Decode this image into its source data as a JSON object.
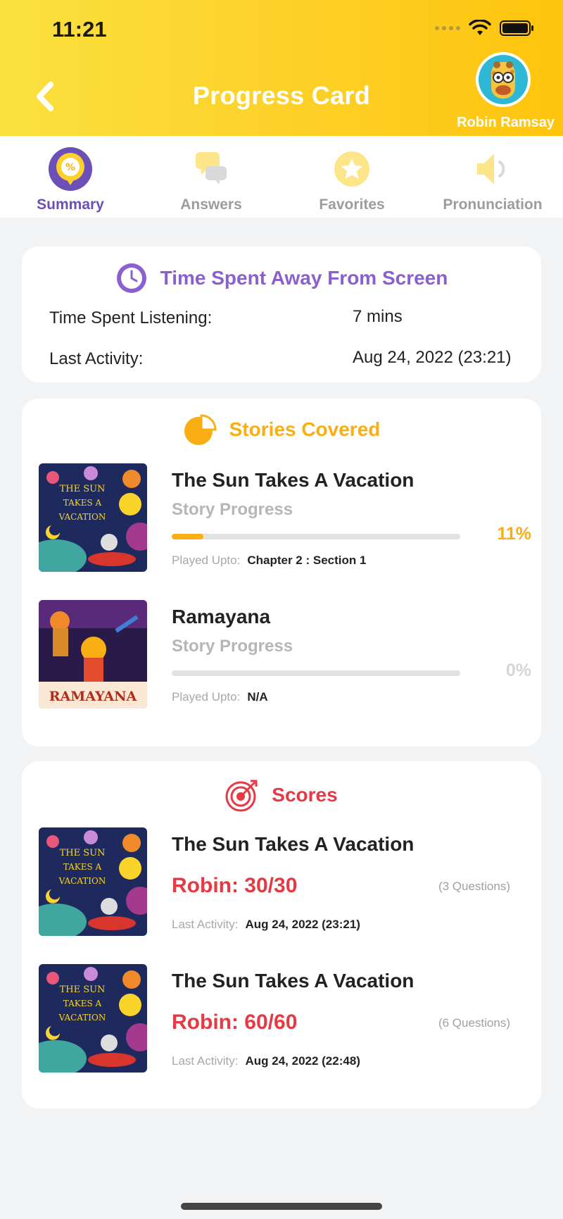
{
  "status_bar": {
    "time": "11:21"
  },
  "header": {
    "title": "Progress Card",
    "user_name": "Robin Ramsay"
  },
  "tabs": [
    {
      "label": "Summary",
      "icon": "percent-badge-icon",
      "active": true
    },
    {
      "label": "Answers",
      "icon": "chat-bubbles-icon",
      "active": false
    },
    {
      "label": "Favorites",
      "icon": "star-icon",
      "active": false
    },
    {
      "label": "Pronunciation",
      "icon": "speaker-icon",
      "active": false
    }
  ],
  "time_card": {
    "title": "Time Spent Away From Screen",
    "rows": [
      {
        "label": "Time Spent Listening:",
        "value": "7 mins"
      },
      {
        "label": "Last Activity:",
        "value": "Aug 24, 2022 (23:21)"
      }
    ]
  },
  "stories_card": {
    "title": "Stories Covered",
    "items": [
      {
        "title": "The Sun Takes A Vacation",
        "subtitle": "Story Progress",
        "progress": 0.11,
        "percent_label": "11%",
        "played_label": "Played Upto:",
        "played_value": "Chapter 2 : Section 1",
        "cover": "sun-vacation"
      },
      {
        "title": "Ramayana",
        "subtitle": "Story Progress",
        "progress": 0,
        "percent_label": "0%",
        "played_label": "Played Upto:",
        "played_value": "N/A",
        "cover": "ramayana"
      }
    ]
  },
  "scores_card": {
    "title": "Scores",
    "items": [
      {
        "title": "The Sun Takes A Vacation",
        "score": "Robin: 30/30",
        "questions": "(3 Questions)",
        "activity_label": "Last Activity:",
        "activity_value": "Aug 24, 2022 (23:21)"
      },
      {
        "title": "The Sun Takes A Vacation",
        "score": "Robin: 60/60",
        "questions": "(6 Questions)",
        "activity_label": "Last Activity:",
        "activity_value": "Aug 24, 2022 (22:48)"
      }
    ]
  },
  "covers": {
    "sun_vacation_text": [
      "THE SUN",
      "TAKES A",
      "VACATION"
    ],
    "ramayana_text": "RAMAYANA"
  },
  "colors": {
    "header_yellow": "#fdd12a",
    "summary_purple": "#6d4fb8",
    "time_title_purple": "#8a5fcf",
    "stories_orange": "#f9ae13",
    "scores_red": "#e53a44"
  }
}
